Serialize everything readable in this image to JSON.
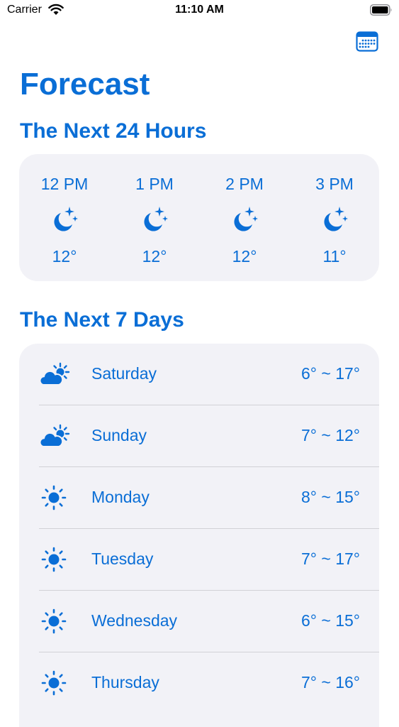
{
  "status_bar": {
    "carrier": "Carrier",
    "time": "11:10 AM"
  },
  "header": {
    "title": "Forecast"
  },
  "hourly": {
    "title": "The Next 24 Hours",
    "items": [
      {
        "time": "12 PM",
        "icon": "moon-stars-icon",
        "temp": "12°"
      },
      {
        "time": "1 PM",
        "icon": "moon-stars-icon",
        "temp": "12°"
      },
      {
        "time": "2 PM",
        "icon": "moon-stars-icon",
        "temp": "12°"
      },
      {
        "time": "3 PM",
        "icon": "moon-stars-icon",
        "temp": "11°"
      }
    ]
  },
  "daily": {
    "title": "The Next 7 Days",
    "items": [
      {
        "day": "Saturday",
        "icon": "cloud-sun-icon",
        "range": "6° ~ 17°"
      },
      {
        "day": "Sunday",
        "icon": "cloud-sun-icon",
        "range": "7° ~ 12°"
      },
      {
        "day": "Monday",
        "icon": "sun-icon",
        "range": "8° ~ 15°"
      },
      {
        "day": "Tuesday",
        "icon": "sun-icon",
        "range": "7° ~ 17°"
      },
      {
        "day": "Wednesday",
        "icon": "sun-icon",
        "range": "6° ~ 15°"
      },
      {
        "day": "Thursday",
        "icon": "sun-icon",
        "range": "7° ~ 16°"
      }
    ]
  },
  "colors": {
    "accent": "#0a6ed6",
    "card_bg": "#f2f2f7",
    "divider": "#d1d1d6"
  }
}
